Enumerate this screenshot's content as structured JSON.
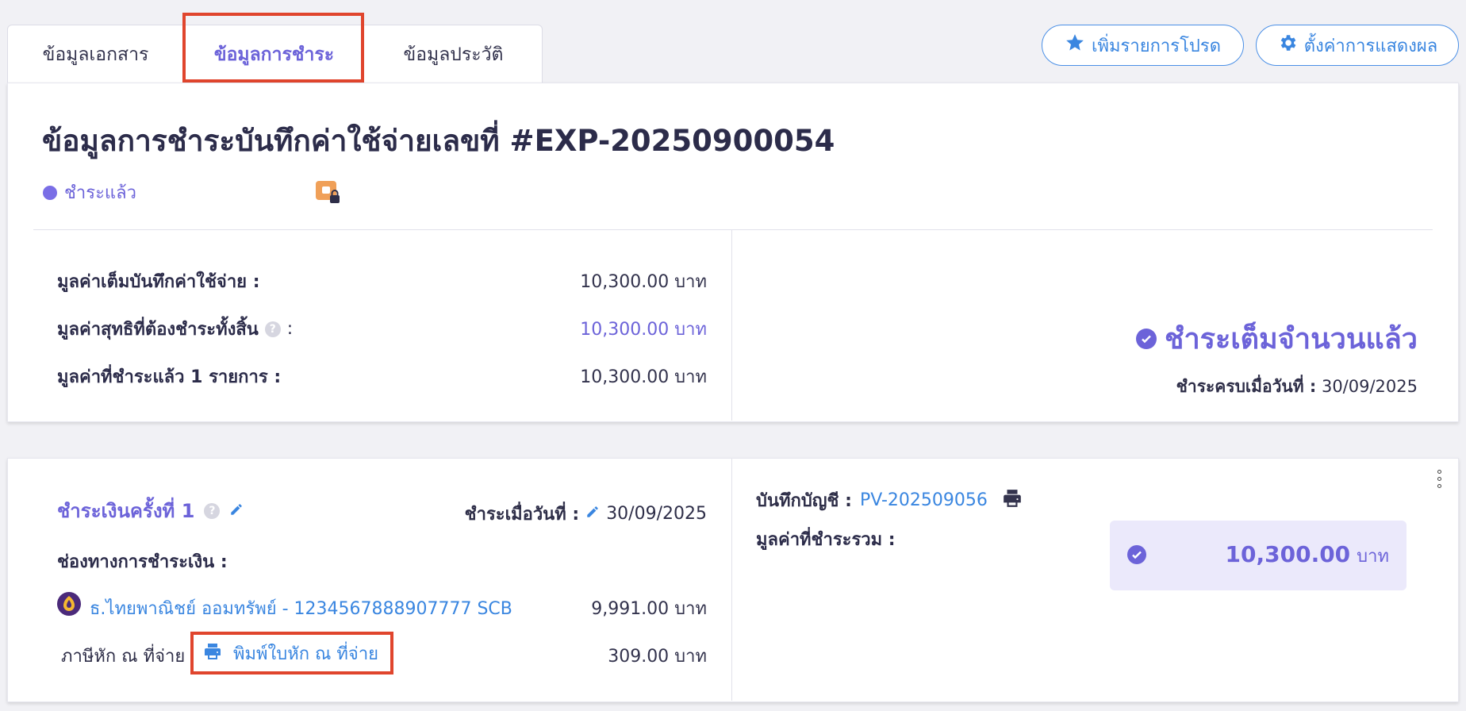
{
  "tabs": [
    {
      "label": "ข้อมูลเอกสาร",
      "active": false
    },
    {
      "label": "ข้อมูลการชำระ",
      "active": true
    },
    {
      "label": "ข้อมูลประวัติ",
      "active": false
    }
  ],
  "actions": {
    "favorite_label": "เพิ่มรายการโปรด",
    "display_settings_label": "ตั้งค่าการแสดงผล"
  },
  "summary": {
    "title": "ข้อมูลการชำระบันทึกค่าใช้จ่ายเลขที่ #EXP-20250900054",
    "status": "ชำระแล้ว",
    "full_amount_label": "มูลค่าเต็มบันทึกค่าใช้จ่าย :",
    "full_amount_value": "10,300.00 บาท",
    "net_amount_label": "มูลค่าสุทธิที่ต้องชำระทั้งสิ้น",
    "net_amount_colon": ":",
    "net_amount_value": "10,300.00 บาท",
    "paid_amount_label": "มูลค่าที่ชำระแล้ว 1 รายการ :",
    "paid_amount_value": "10,300.00 บาท",
    "paid_full_text": "ชำระเต็มจำนวนแล้ว",
    "paid_complete_label": "ชำระครบเมื่อวันที่ :",
    "paid_complete_date": "30/09/2025"
  },
  "payment": {
    "title": "ชำระเงินครั้งที่ 1",
    "paid_on_label": "ชำระเมื่อวันที่ :",
    "paid_on_date": "30/09/2025",
    "channel_label": "ช่องทางการชำระเงิน :",
    "bank_account": "ธ.ไทยพาณิชย์ ออมทรัพย์ - 1234567888907777 SCB",
    "bank_amount": "9,991.00 บาท",
    "withholding_label": "ภาษีหัก ณ ที่จ่าย",
    "print_withholding_label": "พิมพ์ใบหัก ณ ที่จ่าย",
    "withholding_amount": "309.00 บาท",
    "journal_label": "บันทึกบัญชี :",
    "journal_ref": "PV-202509056",
    "total_paid_label": "มูลค่าที่ชำระรวม :",
    "total_paid_amount": "10,300.00",
    "total_paid_unit": "บาท"
  },
  "colors": {
    "accent": "#6c63d9",
    "link": "#3a86e0",
    "highlight": "#e0452d"
  }
}
